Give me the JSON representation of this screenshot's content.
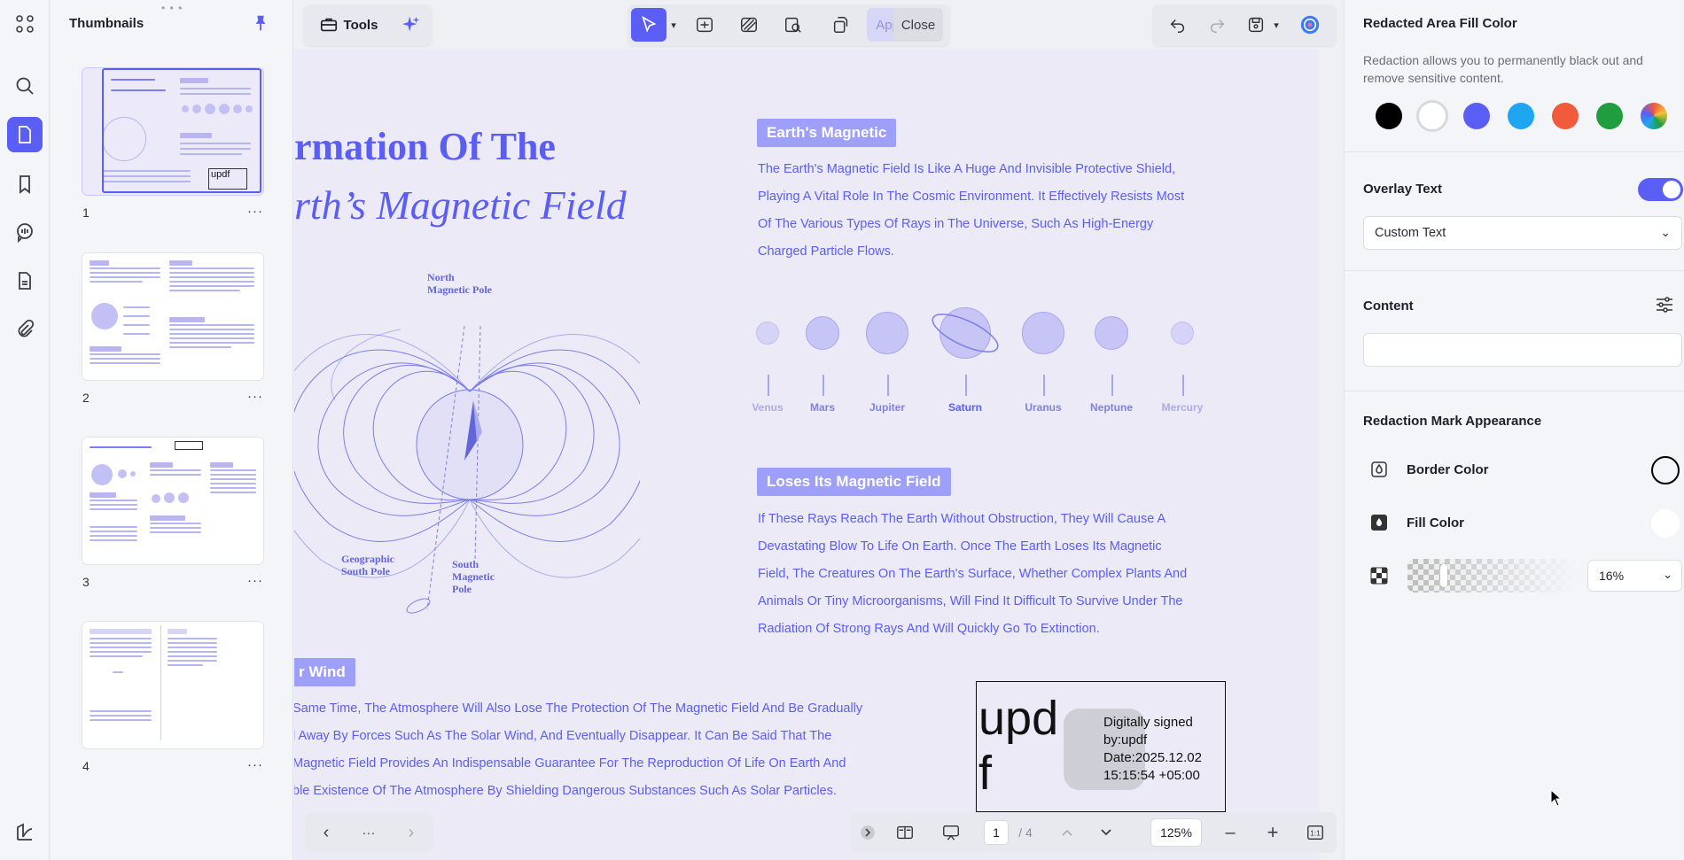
{
  "sidebar_rail": {
    "icons": [
      "apps-icon",
      "search-icon",
      "page-icon",
      "bookmark-icon",
      "comment-icon",
      "form-icon",
      "attachment-icon",
      "sign-icon"
    ]
  },
  "thumbnails": {
    "title": "Thumbnails",
    "pages": [
      {
        "number": "1",
        "more": "···"
      },
      {
        "number": "2",
        "more": "···"
      },
      {
        "number": "3",
        "more": "···"
      },
      {
        "number": "4",
        "more": "···"
      }
    ]
  },
  "toolbar": {
    "tools_label": "Tools",
    "apply_label": "Apply",
    "close_label": "Close"
  },
  "document": {
    "title_line1": "rmation Of The",
    "title_line2": "rth’s Magnetic Field",
    "section1_heading": "Earth's Magnetic",
    "section1_lines": [
      "The Earth's Magnetic Field Is Like A Huge And Invisible Protective Shield,",
      "Playing A Vital Role In The Cosmic Environment. It Effectively Resists Most",
      "Of The Various Types Of Rays in The Universe, Such As High-Energy",
      "Charged Particle Flows."
    ],
    "planets": [
      {
        "name": "Venus",
        "size": 26,
        "center": 866
      },
      {
        "name": "Mars",
        "size": 38,
        "center": 928
      },
      {
        "name": "Jupiter",
        "size": 48,
        "center": 1001
      },
      {
        "name": "Saturn",
        "size": 58,
        "center": 1089
      },
      {
        "name": "Uranus",
        "size": 48,
        "center": 1177
      },
      {
        "name": "Neptune",
        "size": 38,
        "center": 1254
      },
      {
        "name": "Mercury",
        "size": 26,
        "center": 1334
      }
    ],
    "section2_heading": "Loses Its Magnetic Field",
    "section2_lines": [
      "If These Rays Reach The Earth Without Obstruction, They Will Cause A",
      "Devastating Blow To Life On Earth. Once The Earth Loses Its Magnetic",
      "Field, The Creatures On The Earth's Surface, Whether Complex Plants And",
      "Animals Or Tiny Microorganisms, Will Find It Difficult To Survive Under The",
      "Radiation Of Strong Rays And Will Quickly Go To Extinction."
    ],
    "section3_heading": "r Wind",
    "section3_lines": [
      "Same Time, The Atmosphere Will Also Lose The Protection Of The Magnetic Field And Be Gradually",
      "l Away By Forces Such As The Solar Wind, And Eventually Disappear. It Can Be Said That The",
      "Magnetic Field Provides An Indispensable Guarantee For The Reproduction Of Life On Earth And",
      "ble Existence Of The Atmosphere By Shielding Dangerous Substances Such As Solar Particles."
    ],
    "diagram_labels": {
      "north_l1": "North",
      "north_l2": "Magnetic Pole",
      "geo_l1": "Geographic",
      "geo_l2": "South Pole",
      "south_l1": "South",
      "south_l2": "Magnetic",
      "south_l3": "Pole"
    },
    "signature": {
      "big_text_l1": "upd",
      "big_text_l2": "f",
      "line1": "Digitally signed",
      "line2": "by:updf",
      "line3": "Date:2025.12.02",
      "line4": "15:15:54 +05:00"
    }
  },
  "bottom_bar": {
    "current_page": "1",
    "total_pages": "/ 4",
    "zoom": "125%",
    "ellipsis": "···"
  },
  "right_panel": {
    "fill_color_heading": "Redacted Area Fill Color",
    "fill_color_desc": "Redaction allows you to permanently black out and remove sensitive content.",
    "swatches": [
      "#000000",
      "#ffffff",
      "#5b5ef4",
      "#1ea7f0",
      "#f25a3c",
      "#1f9d3f",
      "multicolor"
    ],
    "overlay_text_heading": "Overlay Text",
    "overlay_text_enabled": true,
    "overlay_select_value": "Custom Text",
    "content_heading": "Content",
    "content_value": "",
    "appearance_heading": "Redaction Mark Appearance",
    "border_color_label": "Border Color",
    "fill_color_label": "Fill Color",
    "opacity_value": "16%",
    "colors": {
      "accent": "#5b5ef4",
      "border_swatch": "#000000",
      "fill_swatch": "#ffffff"
    }
  }
}
